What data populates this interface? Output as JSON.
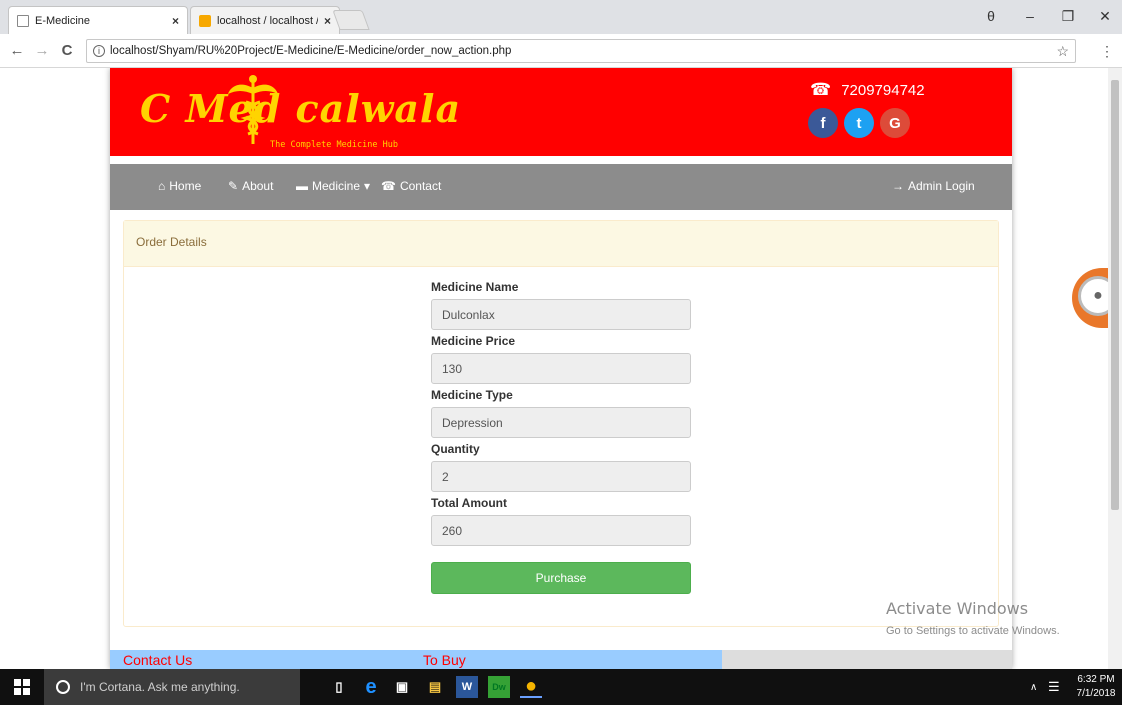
{
  "browser": {
    "tabs": [
      {
        "title": "E-Medicine",
        "close": "×"
      },
      {
        "title": "localhost / localhost / e_",
        "close": "×"
      }
    ],
    "window_controls": {
      "profile": "θ",
      "minimize": "–",
      "restore": "❐",
      "close": "✕"
    },
    "nav": {
      "back": "←",
      "forward": "→",
      "reload": "C"
    },
    "address": "localhost/Shyam/RU%20Project/E-Medicine/E-Medicine/order_now_action.php",
    "address_info": "i",
    "star": "☆",
    "menu": "⋮"
  },
  "site": {
    "logo_text": "C Med calwala",
    "logo_sub": "The Complete Medicine Hub",
    "phone": "7209794742",
    "social": [
      {
        "label": "f",
        "color": "#3b5998"
      },
      {
        "label": "t",
        "color": "#1da1f2"
      },
      {
        "label": "G",
        "color": "#dd4b39"
      }
    ],
    "nav": [
      {
        "label": "Home",
        "icon": "⌂"
      },
      {
        "label": "About",
        "icon": "✎"
      },
      {
        "label": "Medicine",
        "icon": "▬",
        "caret": "▾"
      },
      {
        "label": "Contact",
        "icon": "☎"
      }
    ],
    "admin_login": "Admin Login",
    "admin_icon": "→",
    "brand_red": "#ff0000",
    "nav_gray": "#8c8c8c"
  },
  "order": {
    "heading": "Order Details",
    "fields": [
      {
        "label": "Medicine Name",
        "value": "Dulconlax"
      },
      {
        "label": "Medicine Price",
        "value": "130"
      },
      {
        "label": "Medicine Type",
        "value": "Depression"
      },
      {
        "label": "Quantity",
        "value": "2"
      },
      {
        "label": "Total Amount",
        "value": "260"
      }
    ],
    "purchase_label": "Purchase",
    "purchase_color": "#5cb85c"
  },
  "footer": {
    "contact_us": "Contact Us",
    "to_buy": "To Buy"
  },
  "watermark": {
    "line1": "Activate Windows",
    "line2": "Go to Settings to activate Windows."
  },
  "taskbar": {
    "cortana_placeholder": "I'm Cortana. Ask me anything.",
    "time": "6:32 PM",
    "date": "7/1/2018",
    "tray_arrow": "∧",
    "tray_notify": "☰",
    "apps": [
      {
        "name": "task-view",
        "glyph": "▯"
      },
      {
        "name": "edge",
        "glyph": "e"
      },
      {
        "name": "store",
        "glyph": "▣"
      },
      {
        "name": "file-explorer",
        "glyph": "▤"
      },
      {
        "name": "word",
        "glyph": "W"
      },
      {
        "name": "dreamweaver",
        "glyph": "Dw"
      },
      {
        "name": "chrome",
        "glyph": "●"
      }
    ]
  }
}
